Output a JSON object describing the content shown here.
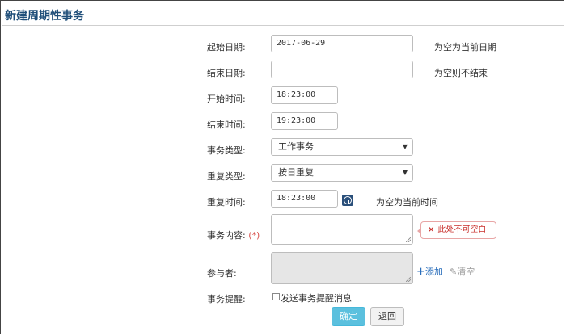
{
  "page": {
    "title": "新建周期性事务"
  },
  "form": {
    "start_date": {
      "label": "起始日期:",
      "value": "2017-06-29",
      "hint": "为空为当前日期"
    },
    "end_date": {
      "label": "结束日期:",
      "value": "",
      "hint": "为空则不结束"
    },
    "start_time": {
      "label": "开始时间:",
      "value": "18:23:00"
    },
    "end_time": {
      "label": "结束时间:",
      "value": "19:23:00"
    },
    "event_type": {
      "label": "事务类型:",
      "value": "工作事务"
    },
    "repeat_type": {
      "label": "重复类型:",
      "value": "按日重复"
    },
    "repeat_time": {
      "label": "重复时间:",
      "value": "18:23:00",
      "hint": "为空为当前时间"
    },
    "content": {
      "label": "事务内容:",
      "required_mark": "(*)",
      "error": "此处不可空白",
      "error_icon": "×"
    },
    "participants": {
      "label": "参与者:",
      "add_icon": "+",
      "add": "添加",
      "clear_icon": "✎",
      "clear": "清空"
    },
    "reminder": {
      "label": "事务提醒:",
      "checkbox_label": "发送事务提醒消息"
    }
  },
  "buttons": {
    "ok": "确定",
    "back": "返回"
  },
  "icons": {
    "clock": "clock-icon",
    "dropdown": "chevron-down-icon"
  },
  "colors": {
    "title": "#1f4e79",
    "primary": "#5bc0de",
    "error": "#c9302c",
    "link": "#2a6ebb"
  }
}
